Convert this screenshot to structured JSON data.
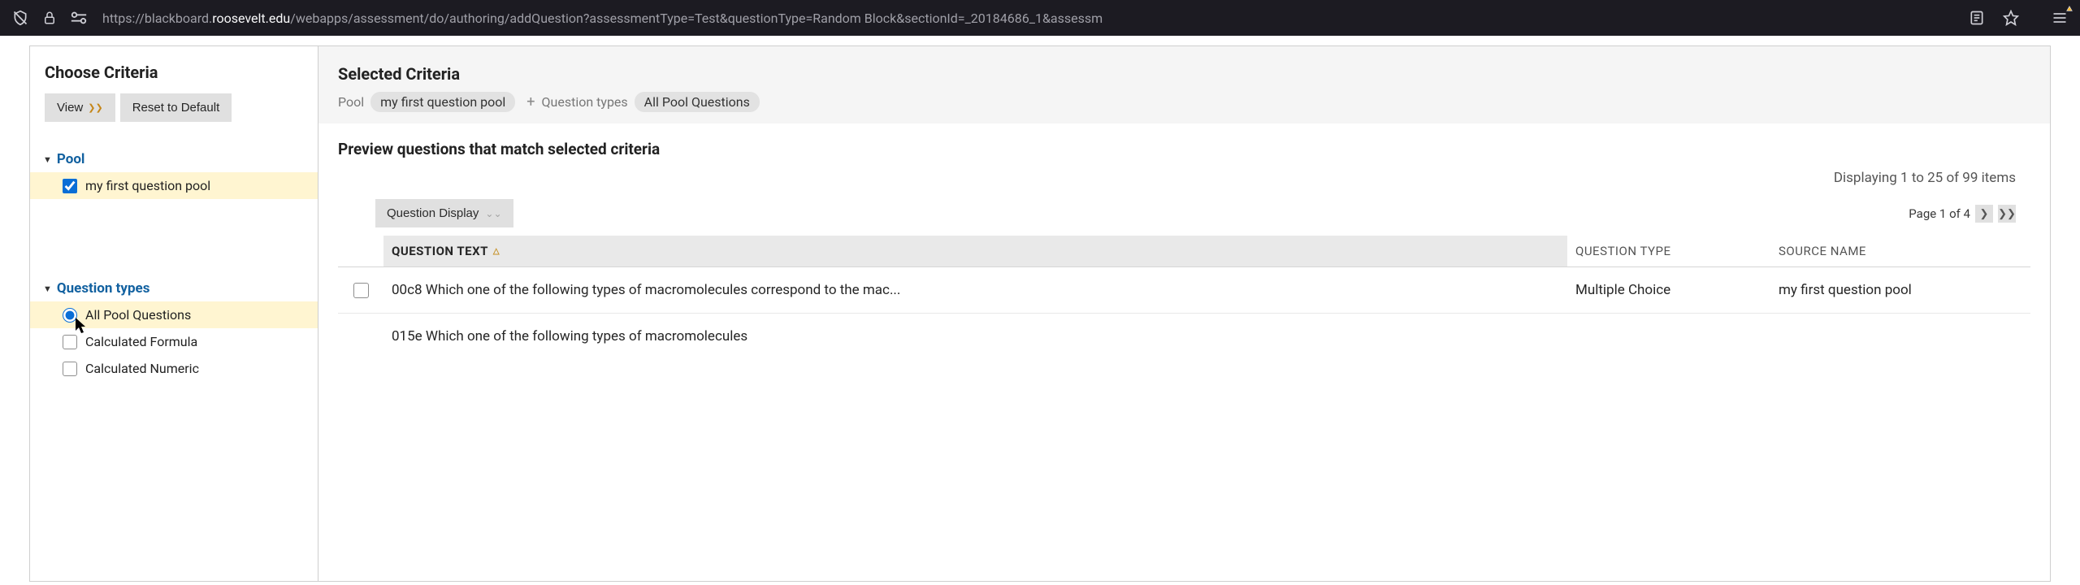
{
  "browser": {
    "url_prefix": "https://blackboard.",
    "url_domain": "roosevelt.edu",
    "url_path": "/webapps/assessment/do/authoring/addQuestion?assessmentType=Test&questionType=Random Block&sectionId=_20184686_1&assessm"
  },
  "sidebar": {
    "title": "Choose Criteria",
    "view_btn": "View",
    "reset_btn": "Reset to Default",
    "pool_section": "Pool",
    "pool_items": [
      {
        "label": "my first question pool",
        "checked": true,
        "highlight": true
      }
    ],
    "qtypes_section": "Question types",
    "qtypes_items": [
      {
        "label": "All Pool Questions",
        "kind": "radio",
        "checked": true,
        "highlight": true
      },
      {
        "label": "Calculated Formula",
        "kind": "check",
        "checked": false,
        "highlight": false
      },
      {
        "label": "Calculated Numeric",
        "kind": "check",
        "checked": false,
        "highlight": false
      }
    ]
  },
  "main": {
    "selected_title": "Selected Criteria",
    "pool_label": "Pool",
    "pool_pill": "my first question pool",
    "qtypes_label": "Question types",
    "qtypes_pill": "All Pool Questions",
    "preview_title": "Preview questions that match selected criteria",
    "displaying": "Displaying 1 to 25 of 99 items",
    "q_display_btn": "Question Display",
    "page_info": "Page 1 of 4",
    "columns": {
      "text": "QUESTION TEXT",
      "type": "QUESTION TYPE",
      "source": "SOURCE NAME"
    },
    "rows": [
      {
        "text": "00c8 Which one of the following types of macromolecules correspond to the mac...",
        "type": "Multiple Choice",
        "source": "my first question pool"
      },
      {
        "text": "015e Which one of the following types of macromolecules",
        "type": "",
        "source": ""
      }
    ]
  }
}
